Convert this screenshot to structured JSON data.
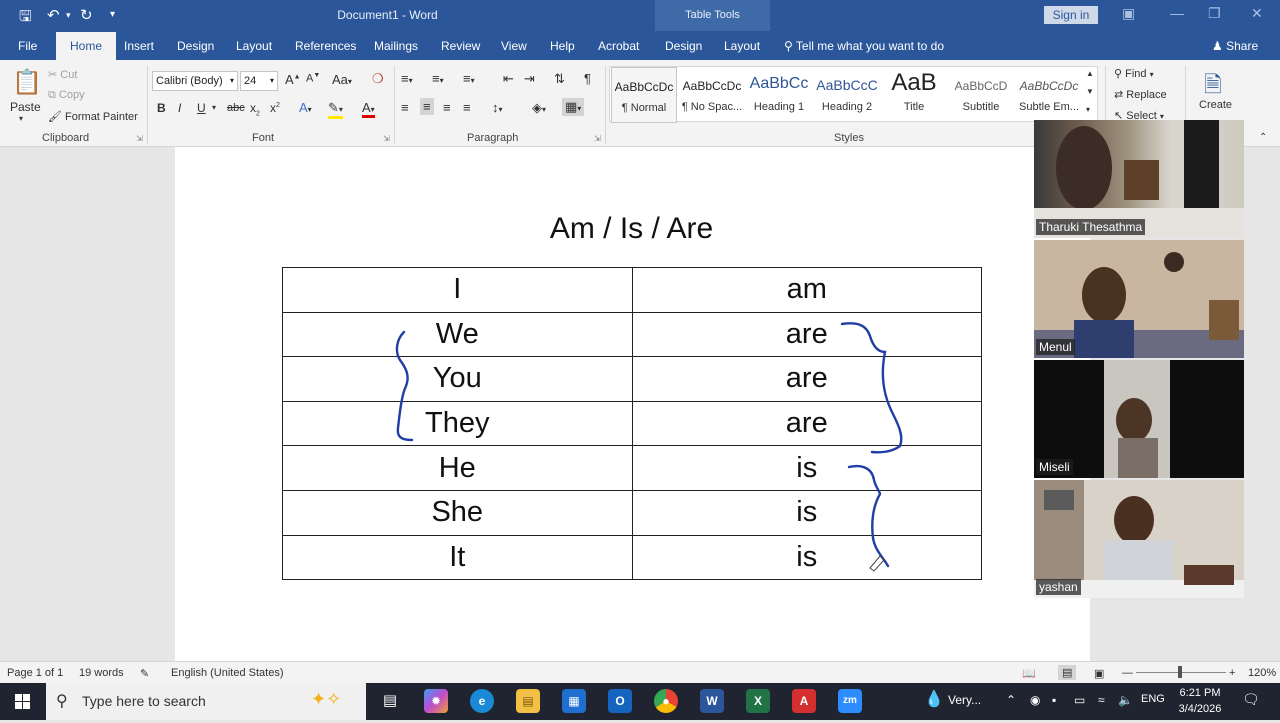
{
  "titlebar": {
    "document": "Document1 - Word",
    "context_group": "Table Tools",
    "sign_in": "Sign in"
  },
  "tabs": [
    "File",
    "Home",
    "Insert",
    "Design",
    "Layout",
    "References",
    "Mailings",
    "Review",
    "View",
    "Help",
    "Acrobat",
    "Design",
    "Layout"
  ],
  "tell_me": "Tell me what you want to do",
  "share": "Share",
  "clipboard": {
    "paste": "Paste",
    "cut": "Cut",
    "copy": "Copy",
    "format_painter": "Format Painter",
    "group": "Clipboard"
  },
  "font": {
    "name": "Calibri (Body)",
    "size": "24",
    "group": "Font"
  },
  "paragraph": {
    "group": "Paragraph"
  },
  "styles": {
    "group": "Styles",
    "items": [
      {
        "preview": "AaBbCcDc",
        "name": "¶ Normal"
      },
      {
        "preview": "AaBbCcDc",
        "name": "¶ No Spac..."
      },
      {
        "preview": "AaBbCc",
        "name": "Heading 1"
      },
      {
        "preview": "AaBbCcC",
        "name": "Heading 2"
      },
      {
        "preview": "AaB",
        "name": "Title"
      },
      {
        "preview": "AaBbCcD",
        "name": "Subtitle"
      },
      {
        "preview": "AaBbCcDc",
        "name": "Subtle Em..."
      }
    ]
  },
  "editing": {
    "find": "Find",
    "replace": "Replace",
    "select": "Select",
    "create_pdf": "Create"
  },
  "document": {
    "title": "Am / Is / Are",
    "rows": [
      [
        "I",
        "am"
      ],
      [
        "We",
        "are"
      ],
      [
        "You",
        "are"
      ],
      [
        "They",
        "are"
      ],
      [
        "He",
        "is"
      ],
      [
        "She",
        "is"
      ],
      [
        "It",
        "is"
      ]
    ]
  },
  "participants": [
    "Tharuki Thesathma",
    "Menul",
    "Miseli",
    "yashan"
  ],
  "status": {
    "page": "Page 1 of 1",
    "words": "19 words",
    "language": "English (United States)",
    "zoom": "120%"
  },
  "taskbar": {
    "search_placeholder": "Type here to search",
    "weather": "Very...",
    "lang": "ENG",
    "time": "6:21 PM",
    "date": "3/4/2026"
  },
  "colors": {
    "word_blue": "#2b579a",
    "ink": "#1f3fa6"
  }
}
